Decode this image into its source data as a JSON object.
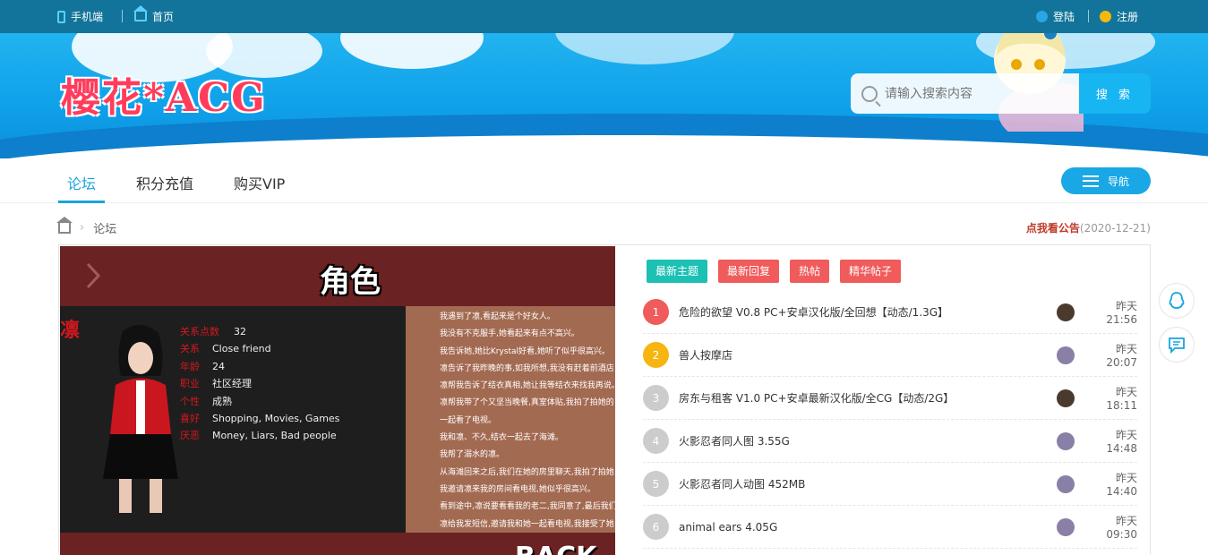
{
  "topbar": {
    "mobile_label": "手机端",
    "home_label": "首页",
    "login_label": "登陆",
    "register_label": "注册"
  },
  "banner": {
    "logo_text": "樱花*ACG",
    "search_placeholder": "请输入搜索内容",
    "search_button": "搜 索"
  },
  "nav": {
    "tabs": [
      {
        "label": "论坛"
      },
      {
        "label": "积分充值"
      },
      {
        "label": "购买VIP"
      }
    ],
    "guide_button": "导航"
  },
  "breadcrumb": {
    "current": "论坛"
  },
  "notice": {
    "link_text": "点我看公告",
    "date": "(2020-12-21)"
  },
  "slide": {
    "title": "角色",
    "character_name": "凛",
    "stats": [
      {
        "key": "关系点数",
        "value": "32"
      },
      {
        "key": "关系",
        "value": "Close friend"
      },
      {
        "key": "年龄",
        "value": "24"
      },
      {
        "key": "职业",
        "value": "社区经理"
      },
      {
        "key": "个性",
        "value": "成熟"
      },
      {
        "key": "喜好",
        "value": "Shopping, Movies, Games"
      },
      {
        "key": "厌恶",
        "value": "Money, Liars, Bad people"
      }
    ],
    "story_lines": [
      "我遇到了凛,看起来是个好女人。",
      "我没有不克服手,她看起来有点不高兴。",
      "我告诉她,她比Krystal好看,她听了似乎很高兴。",
      "凛告诉了我昨晚的事,如我所想,我没有赶着前酒店",
      "凛帮我告诉了结衣真相,她让我等结衣来找我再说。",
      "凛帮我带了个又坚当晚餐,真室体贴,我拍了拍她的",
      "一起看了电视。",
      "我和凛、不久,结衣一起去了海滩。",
      "我帮了溺水的凛。",
      "从海滩回来之后,我们在她的房里聊天,我拍了拍她",
      "我邀请凛来我的房间看电视,她似乎很高兴。",
      "看到途中,凛说要看看我的老二,我同意了,最后我们",
      "凛给我发短信,邀请我和她一起看电视,我接受了她"
    ],
    "back_text": "BACK"
  },
  "thread_tabs": [
    {
      "label": "最新主题",
      "color": "#1cc1b4"
    },
    {
      "label": "最新回复",
      "color": "#f05b5b"
    },
    {
      "label": "热帖",
      "color": "#f05b5b"
    },
    {
      "label": "精华帖子",
      "color": "#f05b5b"
    }
  ],
  "threads": [
    {
      "rank": "1",
      "title": "危险的欲望 V0.8 PC+安卓汉化版/全回想【动态/1.3G】",
      "time": "昨天 21:56",
      "rank_color": "#f05b5b",
      "avatar_color": "#4a3a2e"
    },
    {
      "rank": "2",
      "title": "兽人按摩店",
      "time": "昨天 20:07",
      "rank_color": "#f7b511",
      "avatar_color": "#8a7fa6"
    },
    {
      "rank": "3",
      "title": "房东与租客 V1.0 PC+安卓最新汉化版/全CG【动态/2G】",
      "time": "昨天 18:11",
      "rank_color": "#cccccc",
      "avatar_color": "#4a3a2e"
    },
    {
      "rank": "4",
      "title": "火影忍者同人图 3.55G",
      "time": "昨天 14:48",
      "rank_color": "#cccccc",
      "avatar_color": "#8a7fa6"
    },
    {
      "rank": "5",
      "title": "火影忍者同人动图 452MB",
      "time": "昨天 14:40",
      "rank_color": "#cccccc",
      "avatar_color": "#8a7fa6"
    },
    {
      "rank": "6",
      "title": "animal ears 4.05G",
      "time": "昨天 09:30",
      "rank_color": "#cccccc",
      "avatar_color": "#8a7fa6"
    }
  ]
}
